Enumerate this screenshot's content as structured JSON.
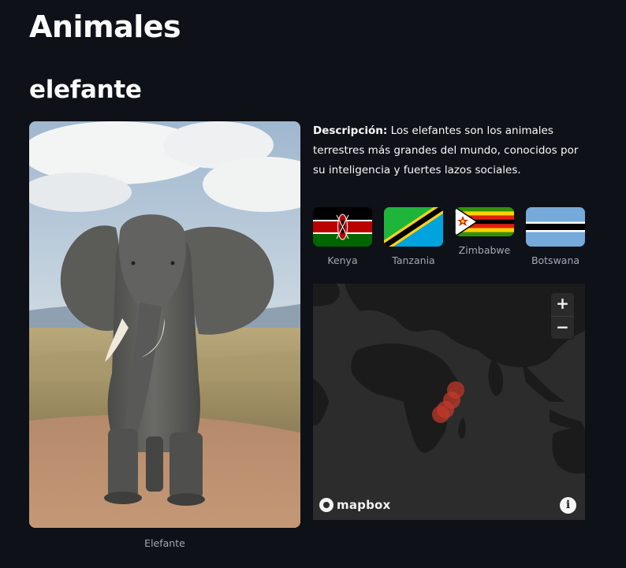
{
  "page": {
    "title": "Animales",
    "subtitle": "elefante"
  },
  "photo": {
    "alt": "Elefante",
    "caption": "Elefante"
  },
  "description": {
    "label": "Descripción:",
    "text": "Los elefantes son los animales terrestres más grandes del mundo, conocidos por su inteligencia y fuertes lazos sociales."
  },
  "countries": [
    {
      "name": "Kenya",
      "flag": "kenya-flag"
    },
    {
      "name": "Tanzania",
      "flag": "tanzania-flag"
    },
    {
      "name": "Zimbabwe",
      "flag": "zimbabwe-flag"
    },
    {
      "name": "Botswana",
      "flag": "botswana-flag"
    }
  ],
  "map": {
    "provider": "mapbox",
    "zoom_in_label": "+",
    "zoom_out_label": "−",
    "info_label": "i",
    "marker_color": "#c0392b",
    "markers": [
      "Kenya",
      "Tanzania",
      "Zimbabwe",
      "Botswana"
    ]
  },
  "colors": {
    "background": "#0e1117",
    "text": "#fafafa",
    "caption": "#a3a8b4"
  }
}
